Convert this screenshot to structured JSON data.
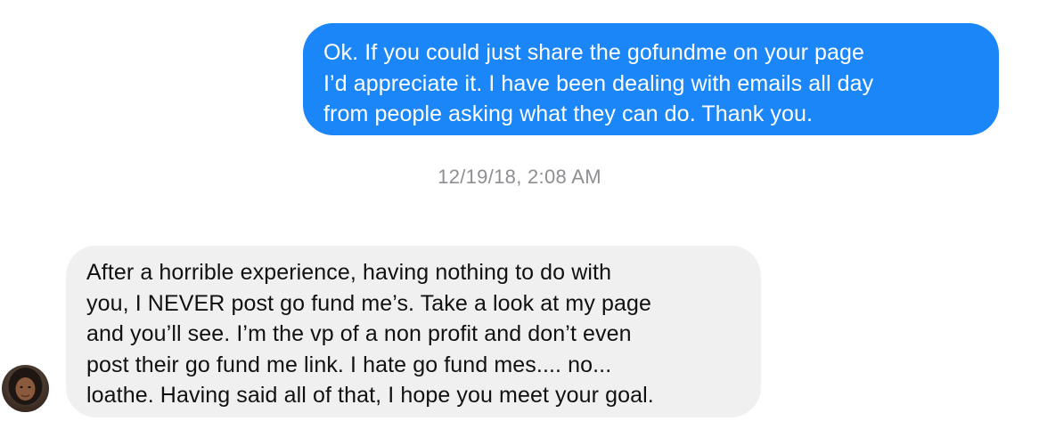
{
  "conversation": {
    "outgoing_message": {
      "lines": [
        "Ok. If you could just share the gofundme on your page",
        "I’d appreciate it. I have been dealing with emails all day",
        "from people asking what they can do.  Thank you."
      ]
    },
    "timestamp": "12/19/18, 2:08 AM",
    "incoming_message": {
      "lines": [
        "After a horrible experience, having nothing to do with",
        "you, I NEVER post go fund me’s. Take a look at my page",
        "and you’ll see. I’m the vp of a non profit and don’t even",
        "post their go fund me link.  I hate go fund mes.... no...",
        "loathe. Having said all of that, I hope you meet your goal."
      ]
    },
    "sender_avatar": {
      "icon": "contact-avatar-icon"
    }
  },
  "colors": {
    "outgoing_bubble": "#1b86f7",
    "incoming_bubble": "#f0f0f0",
    "timestamp_text": "#8e8e93"
  }
}
